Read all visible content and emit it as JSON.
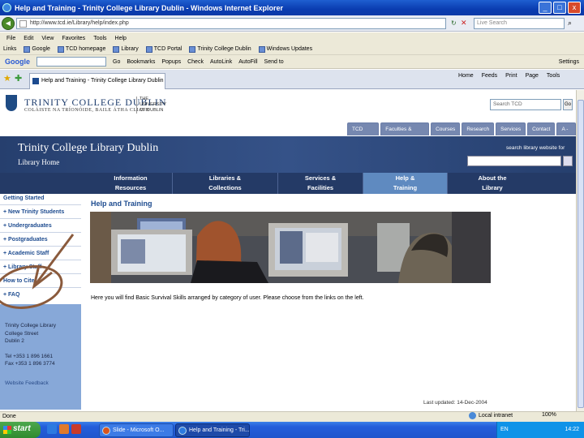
{
  "window": {
    "title": "Help and Training - Trinity College Library Dublin - Windows Internet Explorer",
    "controls": [
      "_",
      "□",
      "x"
    ]
  },
  "address_bar": {
    "url": "http://www.tcd.ie/Library/help/index.php",
    "live_search_placeholder": "Live Search"
  },
  "menu": [
    "File",
    "Edit",
    "View",
    "Favorites",
    "Tools",
    "Help"
  ],
  "links": [
    "Links",
    "Google",
    "TCD homepage",
    "Library",
    "TCD Portal",
    "Trinity College Dublin",
    "Windows Updates"
  ],
  "google_bar": {
    "logo": "Google",
    "go_label": "Go",
    "items": [
      "Bookmarks",
      "Popups",
      "Check",
      "AutoLink",
      "AutoFill",
      "Send to"
    ],
    "settings": "Settings"
  },
  "tab": {
    "title": "Help and Training - Trinity College Library Dublin"
  },
  "command_bar": [
    "Home",
    "Feeds",
    "Print",
    "Page",
    "Tools"
  ],
  "site": {
    "name": "TRINITY COLLEGE DUBLIN",
    "irish_name": "COLÁISTE NA TRÍONÓIDE, BAILE ÁTHA CLIATH",
    "subname": [
      "THE",
      "UNIVERSITY",
      "OF DUBLIN"
    ],
    "search_value": "Search TCD",
    "search_button": "Go",
    "top_tabs": [
      "TCD Home",
      "Faculties & Schools",
      "Courses",
      "Research",
      "Services",
      "Contact",
      "A - Z"
    ]
  },
  "banner": {
    "title": "Trinity College Library Dublin",
    "subtitle": "Library Home",
    "search_label": "search library website for"
  },
  "nav": [
    {
      "line1": "Information",
      "line2": "Resources"
    },
    {
      "line1": "Libraries &",
      "line2": "Collections"
    },
    {
      "line1": "Services &",
      "line2": "Facilities"
    },
    {
      "line1": "Help &",
      "line2": "Training"
    },
    {
      "line1": "About the",
      "line2": "Library"
    }
  ],
  "sidebar": {
    "items": [
      "Getting Started",
      "+ New Trinity Students",
      "+ Undergraduates",
      "+ Postgraduates",
      "+ Academic Staff",
      "+ Library Staff",
      "How to Cite",
      "+ FAQ"
    ],
    "address": [
      "Trinity College Library",
      "College Street",
      "Dublin 2"
    ],
    "tel": "Tel +353 1 896 1661",
    "fax": "Fax +353 1 896 3774",
    "feedback": "Website Feedback"
  },
  "main": {
    "heading": "Help and Training",
    "intro": "Here you will find Basic Survival Skills arranged by category of user. Please choose from the links on the left.",
    "last_updated": "Last updated: 14-Dec-2004"
  },
  "status": {
    "text": "Done",
    "zone": "Local intranet",
    "zoom": "100%"
  },
  "taskbar": {
    "start": "start",
    "buttons": [
      "Slide - Microsoft O...",
      "Help and Training - Tri..."
    ],
    "lang": "EN",
    "clock": "14:22"
  }
}
